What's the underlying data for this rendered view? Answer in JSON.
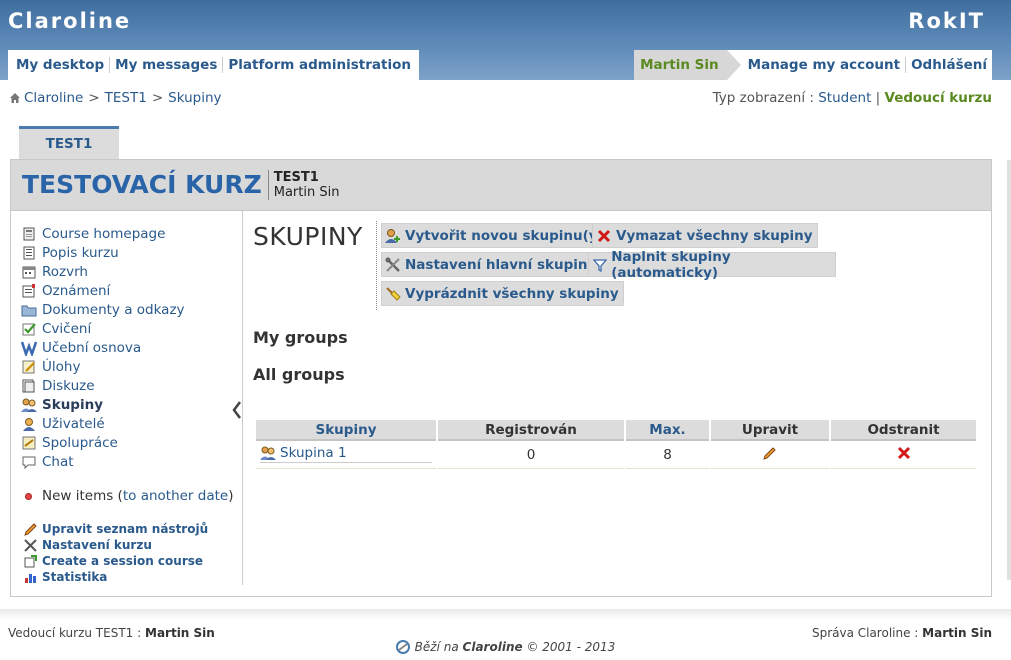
{
  "banner": {
    "platform_name": "Claroline",
    "org_name": "RokIT",
    "user_nav": [
      "My desktop",
      "My messages",
      "Platform administration"
    ],
    "user_name": "Martin Sin",
    "account_nav": [
      "Manage my account",
      "Odhlášení"
    ]
  },
  "breadcrumb": {
    "items": [
      "Claroline",
      "TEST1",
      "Skupiny"
    ],
    "sep": ">"
  },
  "view_mode": {
    "label": "Typ zobrazení :",
    "student": "Student",
    "sep": "|",
    "manager": "Vedoucí kurzu"
  },
  "course": {
    "tab": "TEST1",
    "title": "TESTOVACÍ KURZ",
    "code": "TEST1",
    "holder": "Martin Sin"
  },
  "sidebar": {
    "tools": [
      {
        "label": "Course homepage",
        "icon": "home-icon"
      },
      {
        "label": "Popis kurzu",
        "icon": "description-icon"
      },
      {
        "label": "Rozvrh",
        "icon": "calendar-icon"
      },
      {
        "label": "Oznámení",
        "icon": "announcement-icon"
      },
      {
        "label": "Dokumenty a odkazy",
        "icon": "folder-icon"
      },
      {
        "label": "Cvičení",
        "icon": "checkmark-icon"
      },
      {
        "label": "Učební osnova",
        "icon": "learnpath-icon"
      },
      {
        "label": "Úlohy",
        "icon": "assignment-icon"
      },
      {
        "label": "Diskuze",
        "icon": "forum-icon"
      },
      {
        "label": "Skupiny",
        "icon": "group-icon"
      },
      {
        "label": "Uživatelé",
        "icon": "user-icon"
      },
      {
        "label": "Spolupráce",
        "icon": "wiki-icon"
      },
      {
        "label": "Chat",
        "icon": "chat-icon"
      }
    ],
    "current_tool": "Skupiny",
    "new_items_prefix": "New items (",
    "new_items_link": "to another date",
    "new_items_suffix": ")",
    "admin_links": [
      {
        "label": "Upravit seznam nástrojů",
        "icon": "pencil-icon"
      },
      {
        "label": "Nastavení kurzu",
        "icon": "settings-icon"
      },
      {
        "label": "Create a session course",
        "icon": "session-icon"
      },
      {
        "label": "Statistika",
        "icon": "stats-icon"
      }
    ]
  },
  "content": {
    "title": "SKUPINY",
    "commands": {
      "create": "Vytvořit novou skupinu(y)",
      "delete_all": "Vymazat všechny skupiny",
      "settings": "Nastavení hlavní skupiny",
      "fill": "Naplnit skupiny (automaticky)",
      "empty": "Vyprázdnit všechny skupiny"
    },
    "my_groups": "My groups",
    "all_groups": "All groups",
    "table": {
      "headers": [
        "Skupiny",
        "Registrován",
        "Max.",
        "Upravit",
        "Odstranit"
      ],
      "rows": [
        {
          "name": "Skupina 1",
          "registered": "0",
          "max": "8"
        }
      ]
    }
  },
  "footer": {
    "left_label": "Vedoucí kurzu TEST1 :",
    "left_name": "Martin Sin",
    "right_label": "Správa Claroline :",
    "right_name": "Martin Sin",
    "powered_prefix": "Běží na",
    "powered_name": "Claroline",
    "powered_suffix": "© 2001 - 2013"
  },
  "colors": {
    "banner": "#4a78a8",
    "link": "#2a5a8c",
    "active_green": "#5a8a1f",
    "course_title": "#2a64a8"
  }
}
